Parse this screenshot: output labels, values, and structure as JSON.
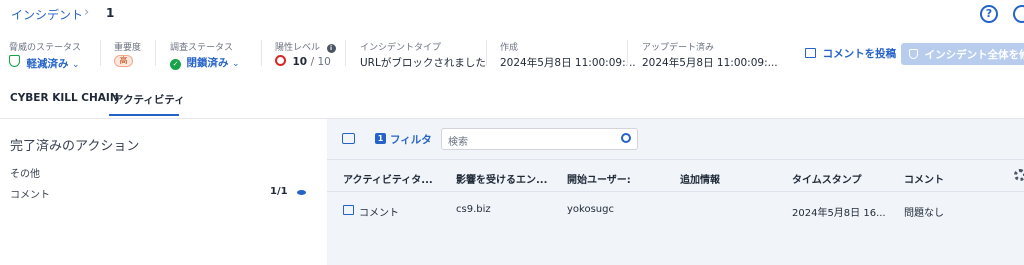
{
  "breadcrumb": {
    "root": "インシデント",
    "separator": "›",
    "current": "1"
  },
  "top_icons": {
    "help": "?"
  },
  "status_bar": {
    "threat_status": {
      "label": "脅威のステータス",
      "value": "軽減済み"
    },
    "severity": {
      "label": "重要度",
      "value": "高"
    },
    "investigation_status": {
      "label": "調査ステータス",
      "value": "閉鎖済み"
    },
    "positivity_level": {
      "label": "陽性レベル",
      "value": "10",
      "max": "/ 10"
    },
    "incident_type": {
      "label": "インシデントタイプ",
      "value": "URLがブロックされました"
    },
    "created": {
      "label": "作成",
      "value": "2024年5月8日 11:00:09:..."
    },
    "updated": {
      "label": "アップデート済み",
      "value": "2024年5月8日 11:00:09:..."
    }
  },
  "actions": {
    "post_comment": "コメントを投稿",
    "fix_all": "インシデント全体を修復"
  },
  "tabs": [
    {
      "label": "CYBER KILL CHAIN"
    },
    {
      "label": "アクティビティ"
    }
  ],
  "left_panel": {
    "title": "完了済みのアクション",
    "section": "その他",
    "items": [
      {
        "label": "コメント",
        "count": "1/1"
      }
    ]
  },
  "toolbar": {
    "filter_count": "1",
    "filter_label": "フィルタ",
    "search_placeholder": "検索"
  },
  "table": {
    "columns": [
      "アクティビティタ...",
      "影響を受けるエン...",
      "開始ユーザー:",
      "追加情報",
      "タイムスタンプ",
      "コメント"
    ],
    "rows": [
      [
        "コメント",
        "cs9.biz",
        "yokosugc",
        "",
        "2024年5月8日 16...",
        "問題なし"
      ]
    ]
  },
  "colors": {
    "accent": "#2563c9",
    "success": "#16a34a",
    "danger": "#dc2626",
    "panel_bg": "#f1f5fa"
  }
}
